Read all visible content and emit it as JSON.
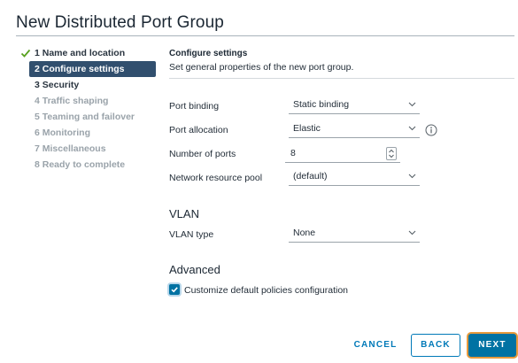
{
  "dialog": {
    "title": "New Distributed Port Group"
  },
  "steps": [
    {
      "label": "1 Name and location",
      "state": "done"
    },
    {
      "label": "2 Configure settings",
      "state": "active"
    },
    {
      "label": "3 Security",
      "state": "next"
    },
    {
      "label": "4 Traffic shaping",
      "state": "disabled"
    },
    {
      "label": "5 Teaming and failover",
      "state": "disabled"
    },
    {
      "label": "6 Monitoring",
      "state": "disabled"
    },
    {
      "label": "7 Miscellaneous",
      "state": "disabled"
    },
    {
      "label": "8 Ready to complete",
      "state": "disabled"
    }
  ],
  "section": {
    "title": "Configure settings",
    "subtitle": "Set general properties of the new port group."
  },
  "fields": {
    "port_binding": {
      "label": "Port binding",
      "value": "Static binding"
    },
    "port_allocation": {
      "label": "Port allocation",
      "value": "Elastic"
    },
    "number_of_ports": {
      "label": "Number of ports",
      "value": "8"
    },
    "network_resource_pool": {
      "label": "Network resource pool",
      "value": "(default)"
    }
  },
  "vlan": {
    "heading": "VLAN",
    "type_label": "VLAN type",
    "type_value": "None"
  },
  "advanced": {
    "heading": "Advanced",
    "customize_label": "Customize default policies configuration",
    "customize_checked": true
  },
  "footer": {
    "cancel": "CANCEL",
    "back": "BACK",
    "next": "NEXT"
  },
  "colors": {
    "accent": "#0072a3",
    "active_step_bg": "#314f6e",
    "check_green": "#5aa220",
    "focus_ring": "#e89a3c"
  }
}
